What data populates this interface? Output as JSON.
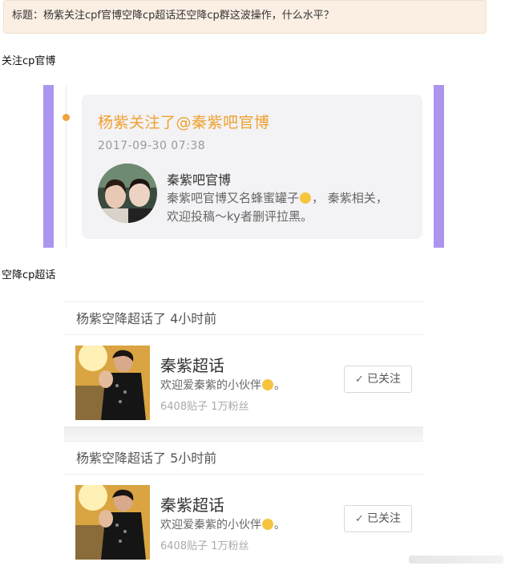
{
  "post": {
    "title": "标题：杨紫关注cpf官博空降cp超话还空降cp群这波操作，什么水平？"
  },
  "sections": {
    "follow_label": "关注cp官博",
    "supertopic_label": "空降cp超话"
  },
  "follow_card": {
    "headline": "杨紫关注了@秦紫吧官博",
    "timestamp": "2017-09-30 07:38",
    "account_name": "秦紫吧官博",
    "description_line1_a": "秦紫吧官博又名蜂蜜罐子",
    "description_line1_b": "，  秦紫相关，",
    "description_line2": "欢迎投稿～ky者删评拉黑。",
    "emoji": "relieved-face",
    "accent_color": "#f0a030",
    "side_bar_color": "#ac95ee"
  },
  "super_topics": [
    {
      "header": "杨紫空降超话了 4小时前",
      "name": "秦紫超话",
      "description": "欢迎爱秦紫的小伙伴",
      "description_end": "。",
      "stats": "6408贴子  1万粉丝",
      "button_icon": "✓",
      "button_label": "已关注"
    },
    {
      "header": "杨紫空降超话了 5小时前",
      "name": "秦紫超话",
      "description": "欢迎爱秦紫的小伙伴",
      "description_end": "。",
      "stats": "6408贴子  1万粉丝",
      "button_icon": "✓",
      "button_label": "已关注"
    }
  ]
}
